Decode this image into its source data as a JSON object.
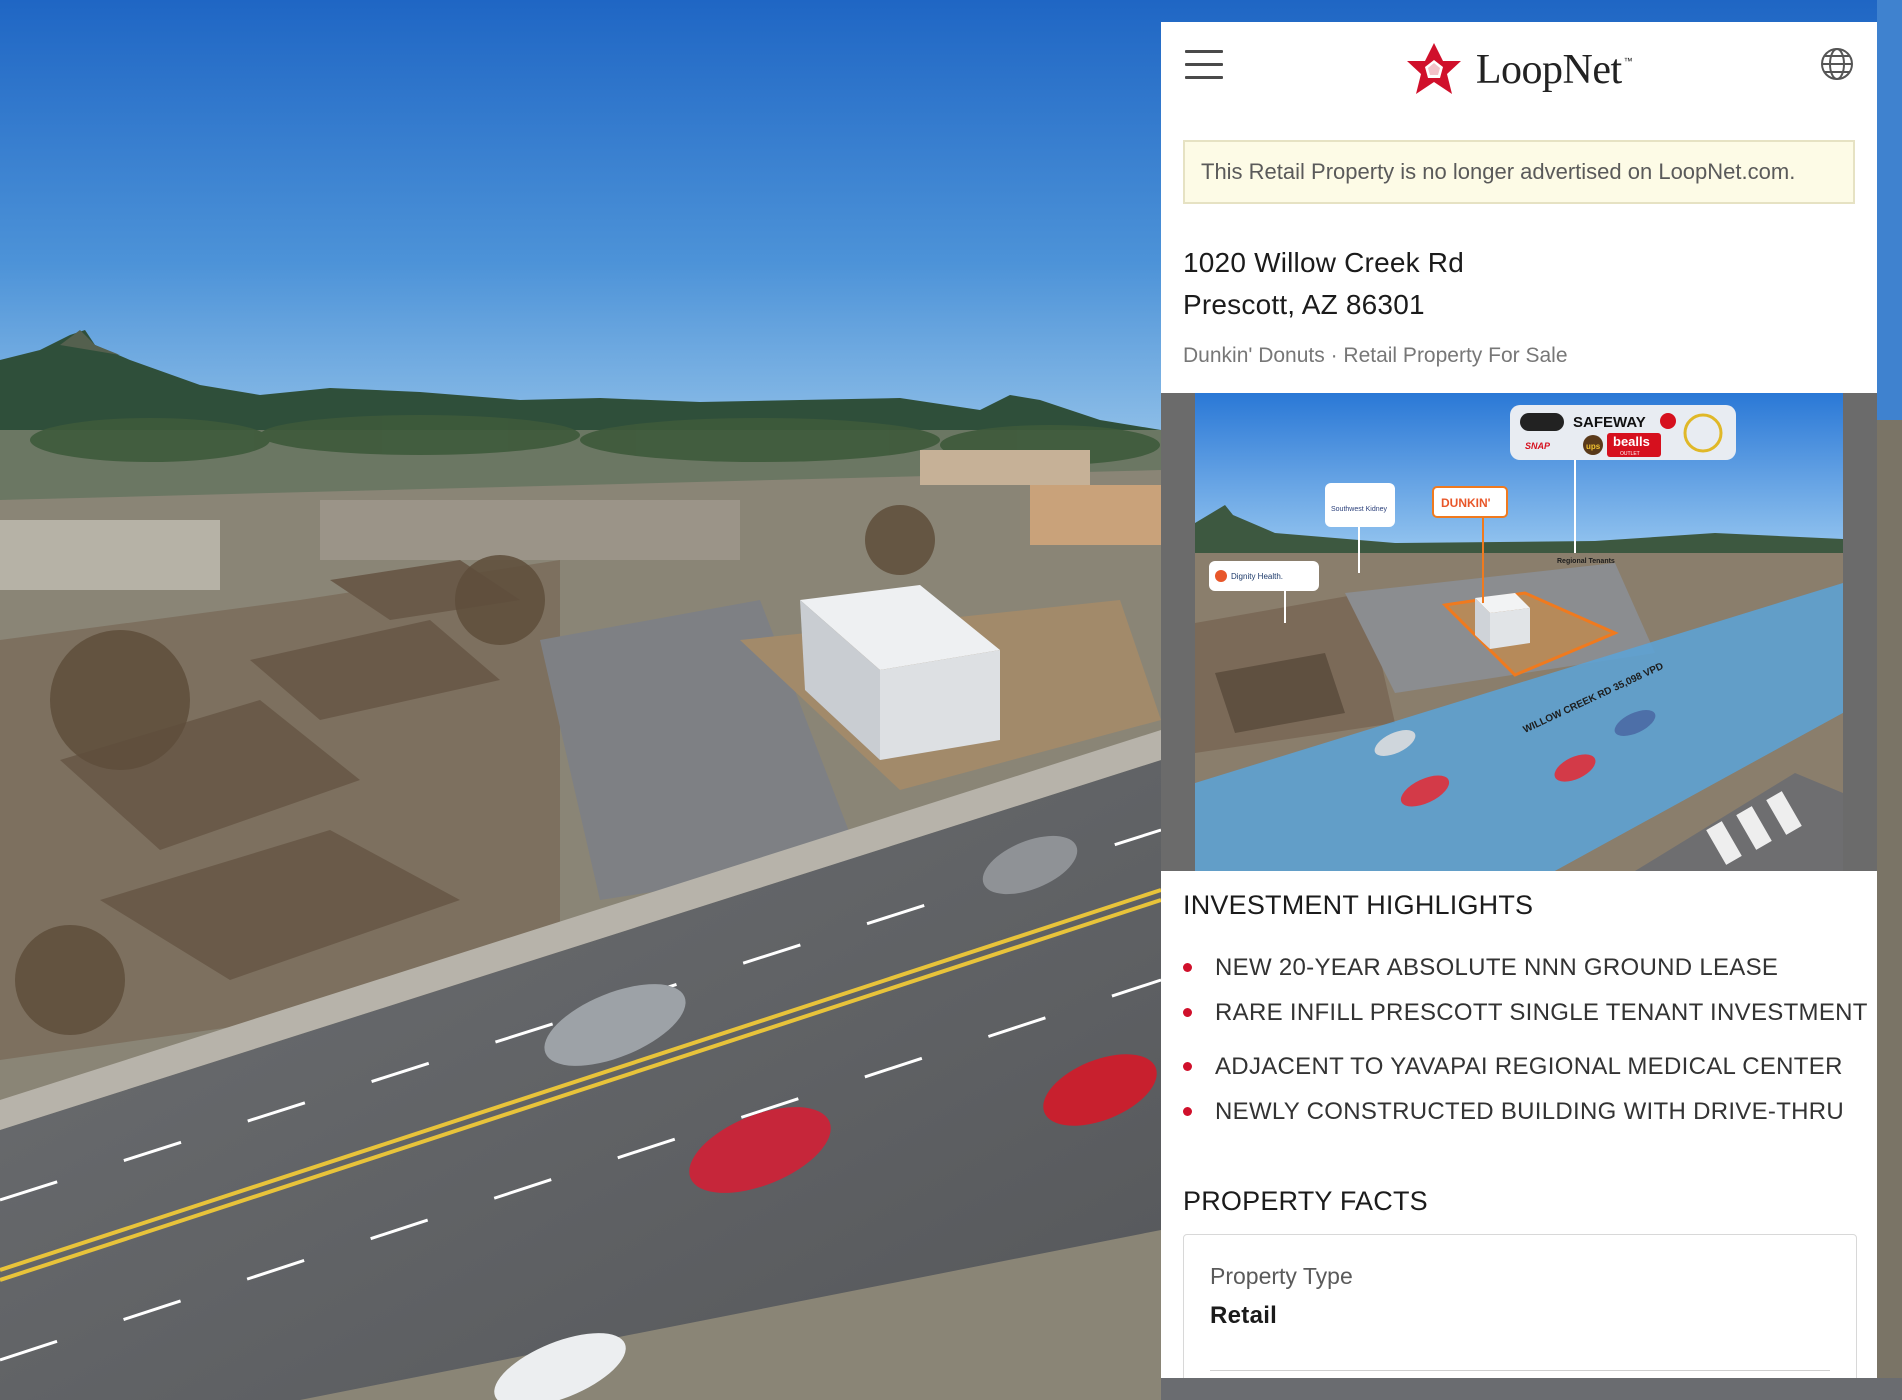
{
  "header": {
    "brand": "LoopNet",
    "trademark": "™",
    "menu_icon": "hamburger-menu-icon",
    "globe_icon": "globe-icon",
    "brand_color": "#d0102b"
  },
  "notice": {
    "text": "This Retail Property is no longer advertised on LoopNet.com."
  },
  "listing": {
    "address_line1": "1020 Willow Creek Rd",
    "address_line2": "Prescott, AZ 86301",
    "subtitle": "Dunkin' Donuts · Retail Property For Sale"
  },
  "hero": {
    "labels": {
      "safeway": "SAFEWAY",
      "ups": "ups",
      "bealls": "bealls",
      "outlet": "OUTLET",
      "snap": "SNAP",
      "dunkin": "DUNKIN'",
      "southwest_kidney": "Southwest Kidney",
      "dignity_health": "Dignity Health.",
      "regional_tenants": "Regional Tenants",
      "traffic": "WILLOW CREEK RD 35,098 VPD"
    }
  },
  "highlights": {
    "title": "INVESTMENT HIGHLIGHTS",
    "items": [
      "NEW 20-YEAR ABSOLUTE NNN GROUND LEASE",
      "RARE INFILL PRESCOTT SINGLE TENANT INVESTMENT",
      "ADJACENT TO YAVAPAI REGIONAL MEDICAL CENTER",
      "NEWLY CONSTRUCTED BUILDING WITH DRIVE-THRU"
    ]
  },
  "facts": {
    "title": "PROPERTY FACTS",
    "rows": [
      {
        "label": "Property Type",
        "value": "Retail"
      }
    ]
  }
}
